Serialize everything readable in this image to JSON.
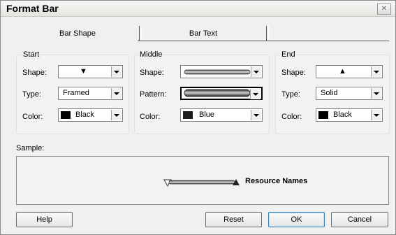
{
  "window": {
    "title": "Format Bar",
    "close_glyph": "✕"
  },
  "tabs": [
    {
      "label": "Bar Shape",
      "active": true
    },
    {
      "label": "Bar Text",
      "active": false
    }
  ],
  "start": {
    "title": "Start",
    "shape_label": "Shape:",
    "shape_value": "▼",
    "type_label": "Type:",
    "type_value": "Framed",
    "color_label": "Color:",
    "color_value": "Black",
    "color_hex": "#000000"
  },
  "middle": {
    "title": "Middle",
    "shape_label": "Shape:",
    "pattern_label": "Pattern:",
    "color_label": "Color:",
    "color_value": "Blue",
    "color_hex": "#1c1c1c"
  },
  "end": {
    "title": "End",
    "shape_label": "Shape:",
    "shape_value": "▲",
    "type_label": "Type:",
    "type_value": "Solid",
    "color_label": "Color:",
    "color_value": "Black",
    "color_hex": "#000000"
  },
  "sample": {
    "label": "Sample:",
    "text": "Resource Names"
  },
  "buttons": {
    "help": "Help",
    "reset": "Reset",
    "ok": "OK",
    "cancel": "Cancel"
  }
}
